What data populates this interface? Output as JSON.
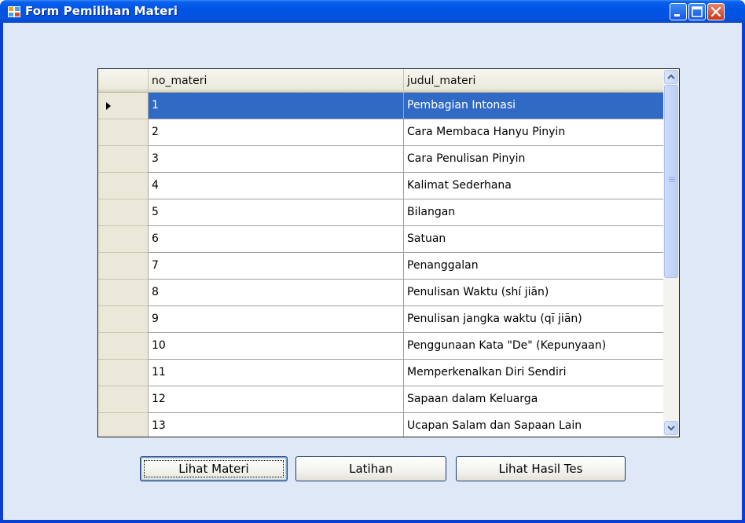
{
  "window": {
    "title": "Form Pemilihan Materi"
  },
  "grid": {
    "columns": [
      "no_materi",
      "judul_materi"
    ],
    "selected_row": 0,
    "rows": [
      [
        "1",
        "Pembagian Intonasi"
      ],
      [
        "2",
        "Cara Membaca Hanyu Pinyin"
      ],
      [
        "3",
        "Cara Penulisan Pinyin"
      ],
      [
        "4",
        "Kalimat Sederhana"
      ],
      [
        "5",
        "Bilangan"
      ],
      [
        "6",
        "Satuan"
      ],
      [
        "7",
        "Penanggalan"
      ],
      [
        "8",
        "Penulisan Waktu (shí jiān)"
      ],
      [
        "9",
        "Penulisan jangka waktu (qī jiān)"
      ],
      [
        "10",
        "Penggunaan Kata \"De\" (Kepunyaan)"
      ],
      [
        "11",
        "Memperkenalkan Diri Sendiri"
      ],
      [
        "12",
        "Sapaan dalam Keluarga"
      ],
      [
        "13",
        "Ucapan Salam dan Sapaan Lain"
      ]
    ]
  },
  "buttons": {
    "lihat_materi": "Lihat Materi",
    "latihan": "Latihan",
    "lihat_hasil_tes": "Lihat Hasil Tes"
  },
  "icons": {
    "app": "form-app-icon",
    "minimize": "minimize-icon",
    "maximize": "maximize-icon",
    "close": "close-icon",
    "row_pointer": "current-row-arrow-icon",
    "scroll_up": "scroll-up-icon",
    "scroll_down": "scroll-down-icon"
  },
  "colors": {
    "titlebar": "#0054e3",
    "client_background": "#dfe8f7",
    "selection": "#316ac5",
    "close_button": "#c8381a"
  }
}
